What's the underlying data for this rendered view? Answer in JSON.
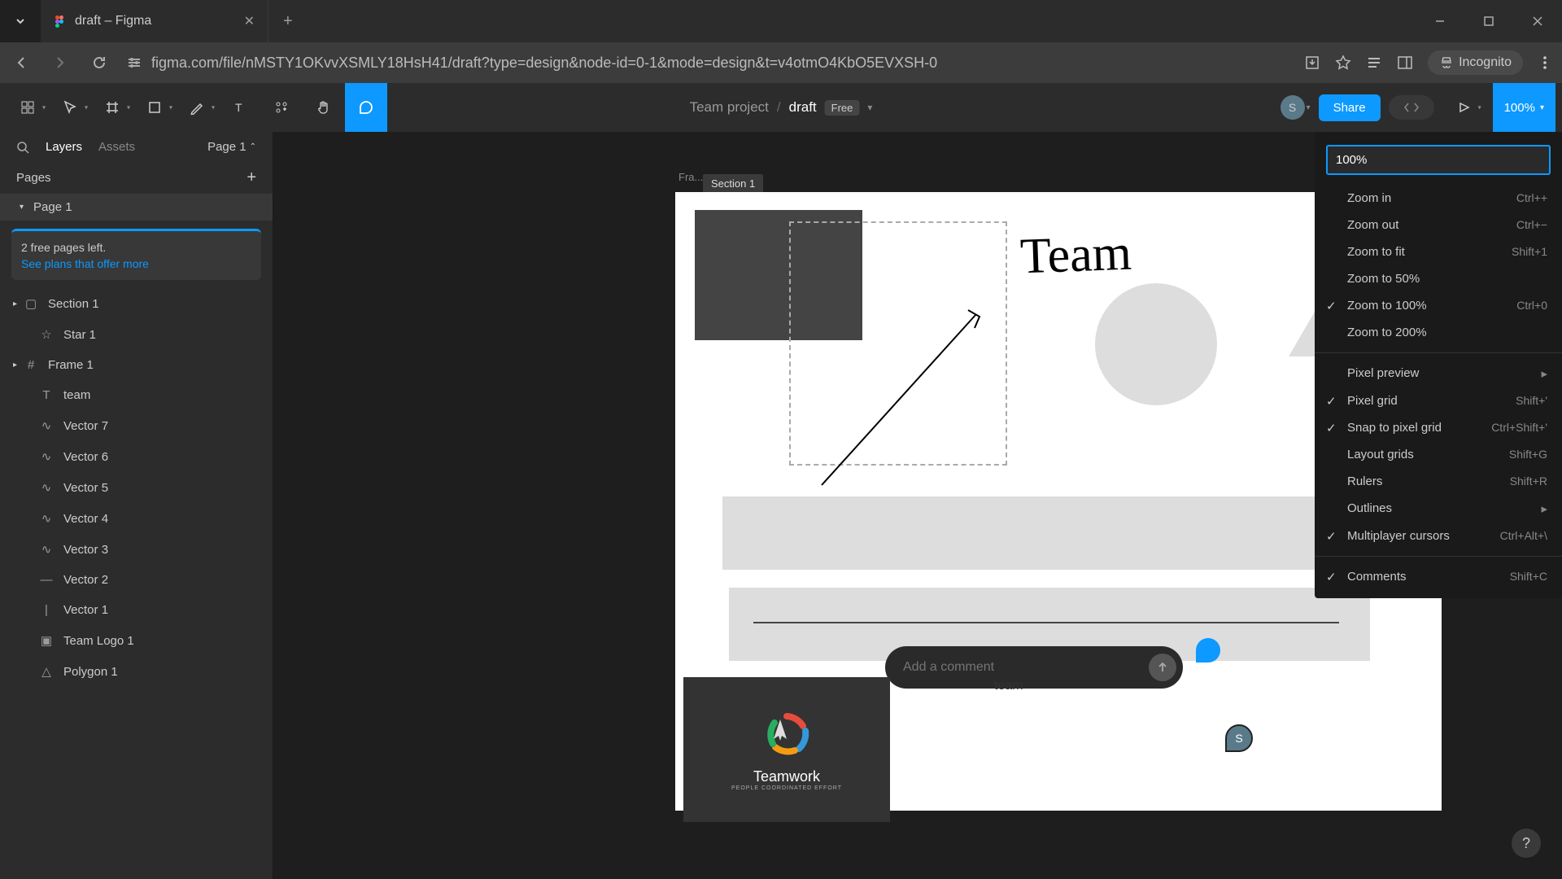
{
  "browser": {
    "tab_title": "draft – Figma",
    "url": "figma.com/file/nMSTY1OKvvXSMLY18HsH41/draft?type=design&node-id=0-1&mode=design&t=v4otmO4KbO5EVXSH-0",
    "incognito_label": "Incognito"
  },
  "toolbar": {
    "breadcrumb_project": "Team project",
    "breadcrumb_file": "draft",
    "plan_badge": "Free",
    "share_label": "Share",
    "avatar_letter": "S",
    "zoom_level": "100%"
  },
  "left_panel": {
    "layers_tab": "Layers",
    "assets_tab": "Assets",
    "page_selector": "Page 1",
    "pages_heading": "Pages",
    "current_page": "Page 1",
    "upgrade_msg": "2 free pages left.",
    "upgrade_link": "See plans that offer more",
    "layers": [
      {
        "name": "Section 1",
        "icon": "▢",
        "nest": 0
      },
      {
        "name": "Star 1",
        "icon": "☆",
        "nest": 1
      },
      {
        "name": "Frame 1",
        "icon": "#",
        "nest": 0
      },
      {
        "name": "team",
        "icon": "T",
        "nest": 1
      },
      {
        "name": "Vector 7",
        "icon": "∿",
        "nest": 1
      },
      {
        "name": "Vector 6",
        "icon": "∿",
        "nest": 1
      },
      {
        "name": "Vector 5",
        "icon": "∿",
        "nest": 1
      },
      {
        "name": "Vector 4",
        "icon": "∿",
        "nest": 1
      },
      {
        "name": "Vector 3",
        "icon": "∿",
        "nest": 1
      },
      {
        "name": "Vector 2",
        "icon": "—",
        "nest": 1
      },
      {
        "name": "Vector 1",
        "icon": "|",
        "nest": 1
      },
      {
        "name": "Team Logo 1",
        "icon": "▣",
        "nest": 1
      },
      {
        "name": "Polygon 1",
        "icon": "△",
        "nest": 1
      }
    ]
  },
  "canvas": {
    "frame_label": "Fra...",
    "section_tag": "Section 1",
    "team_script": "Team",
    "team_text": "team",
    "teamwork_title": "Teamwork",
    "teamwork_subtitle": "PEOPLE COORDINATED EFFORT",
    "comment_placeholder": "Add a comment",
    "cursor_letter": "S"
  },
  "zoom_menu": {
    "input_value": "100%",
    "items_a": [
      {
        "label": "Zoom in",
        "shortcut": "Ctrl++"
      },
      {
        "label": "Zoom out",
        "shortcut": "Ctrl+−"
      },
      {
        "label": "Zoom to fit",
        "shortcut": "Shift+1"
      },
      {
        "label": "Zoom to 50%",
        "shortcut": ""
      },
      {
        "label": "Zoom to 100%",
        "shortcut": "Ctrl+0",
        "checked": true
      },
      {
        "label": "Zoom to 200%",
        "shortcut": ""
      }
    ],
    "items_b": [
      {
        "label": "Pixel preview",
        "submenu": true
      },
      {
        "label": "Pixel grid",
        "shortcut": "Shift+'",
        "checked": true
      },
      {
        "label": "Snap to pixel grid",
        "shortcut": "Ctrl+Shift+'",
        "checked": true
      },
      {
        "label": "Layout grids",
        "shortcut": "Shift+G"
      },
      {
        "label": "Rulers",
        "shortcut": "Shift+R"
      },
      {
        "label": "Outlines",
        "submenu": true
      },
      {
        "label": "Multiplayer cursors",
        "shortcut": "Ctrl+Alt+\\",
        "checked": true
      }
    ],
    "items_c": [
      {
        "label": "Comments",
        "shortcut": "Shift+C",
        "checked": true
      }
    ]
  }
}
